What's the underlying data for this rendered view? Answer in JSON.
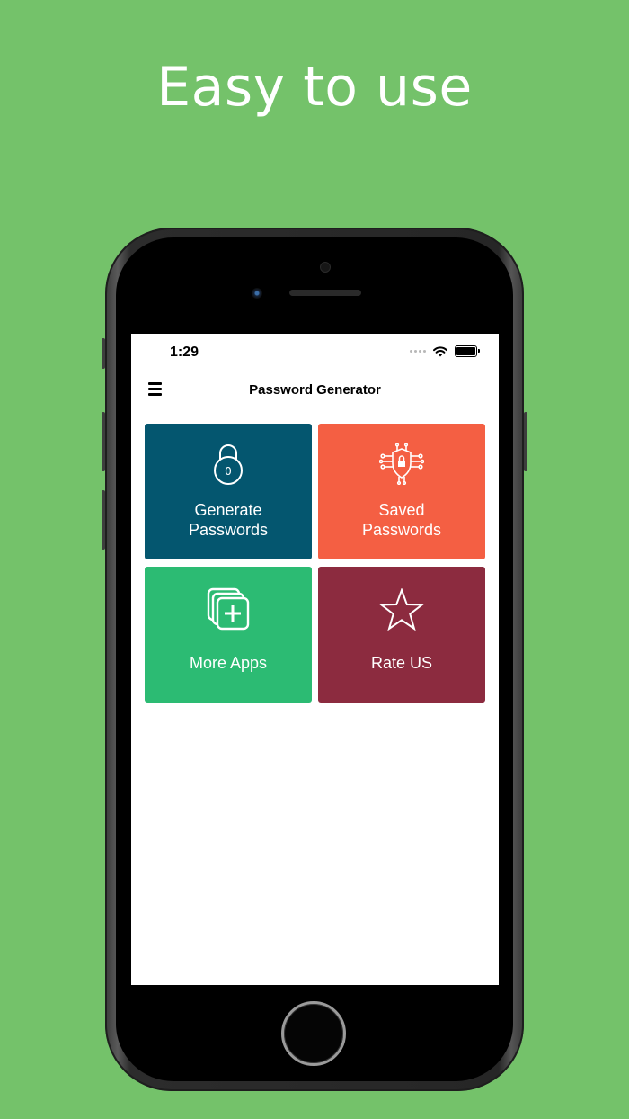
{
  "promo": {
    "headline": "Easy to use"
  },
  "status_bar": {
    "time": "1:29"
  },
  "nav": {
    "title": "Password Generator"
  },
  "tiles": [
    {
      "line1": "Generate",
      "line2": "Passwords",
      "color": "#04566f",
      "icon": "padlock-icon"
    },
    {
      "line1": "Saved",
      "line2": "Passwords",
      "color": "#f45f43",
      "icon": "shield-lock-circuit-icon"
    },
    {
      "line1": "More Apps",
      "line2": "",
      "color": "#2cbb73",
      "icon": "add-copy-icon"
    },
    {
      "line1": "Rate US",
      "line2": "",
      "color": "#8c2b3f",
      "icon": "star-icon"
    }
  ],
  "colors": {
    "background": "#74c26a",
    "screen": "#ffffff"
  }
}
